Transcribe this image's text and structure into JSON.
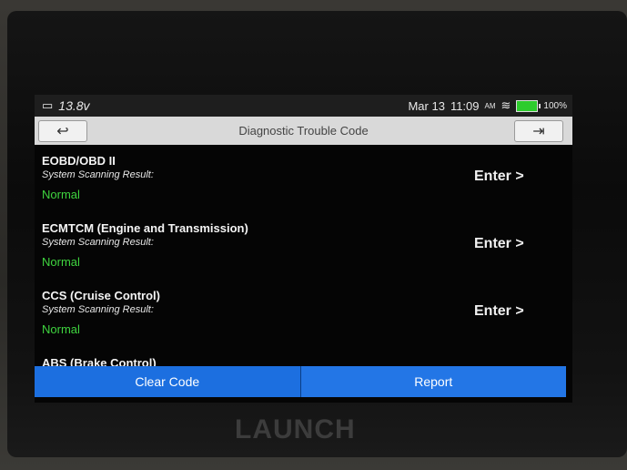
{
  "status": {
    "voltage": "13.8v",
    "date": "Mar 13",
    "time": "11:09",
    "ampm": "AM",
    "battery_pct": "100%"
  },
  "title": "Diagnostic Trouble Code",
  "systems": [
    {
      "name": "EOBD/OBD II",
      "subtitle": "System Scanning Result:",
      "status": "Normal",
      "action": "Enter >"
    },
    {
      "name": "ECMTCM (Engine and Transmission)",
      "subtitle": "System Scanning Result:",
      "status": "Normal",
      "action": "Enter >"
    },
    {
      "name": "CCS (Cruise Control)",
      "subtitle": "System Scanning Result:",
      "status": "Normal",
      "action": "Enter >"
    },
    {
      "name": "ABS (Brake Control)"
    }
  ],
  "buttons": {
    "clear": "Clear Code",
    "report": "Report"
  },
  "brand": "LAUNCH",
  "colors": {
    "accent": "#1c6fe0",
    "normal": "#3fd43f",
    "battery": "#2ecc2e"
  }
}
